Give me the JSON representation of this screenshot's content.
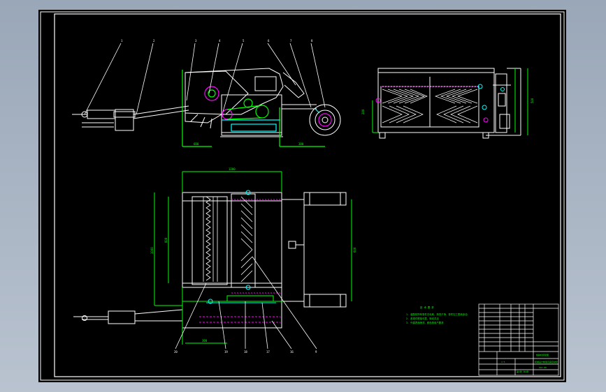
{
  "drawing": {
    "background_color": "#000000",
    "viewport_color": "#a7b2c2",
    "line_colors": {
      "outline": "#ffffff",
      "dimension": "#00ff00",
      "hidden": "#ff00ff",
      "highlight": "#00ffff",
      "hatch": "#ffffff"
    },
    "balloon_labels_top": [
      "1",
      "2",
      "3",
      "4",
      "5",
      "6",
      "7",
      "8"
    ],
    "balloon_labels_bottom": [
      "20",
      "19",
      "18",
      "17",
      "16",
      "9"
    ],
    "dim_texts": {
      "side_left": "600",
      "side_right": "300",
      "front_height": "280",
      "front_side": "500",
      "plan_width": "1200",
      "plan_height_outer": "1000",
      "plan_height_inner": "800",
      "plan_right": "600",
      "plan_bottom": "300"
    },
    "notes": {
      "title": "技 术 要 求",
      "line1": "1. 装配前所有零件去毛刺，清洗干净，零件加工表面涂油",
      "line2": "2. 各零件联接可靠，转动灵活",
      "line3": "3. 外露表面喷漆，颜色按用户要求"
    },
    "title_block": {
      "drawing_name": "旋耕机装配图",
      "company": "机械设计制造及其自动化",
      "scale": "1:5",
      "sheet": "第1张 共1张",
      "code": "XGJ-00"
    }
  }
}
